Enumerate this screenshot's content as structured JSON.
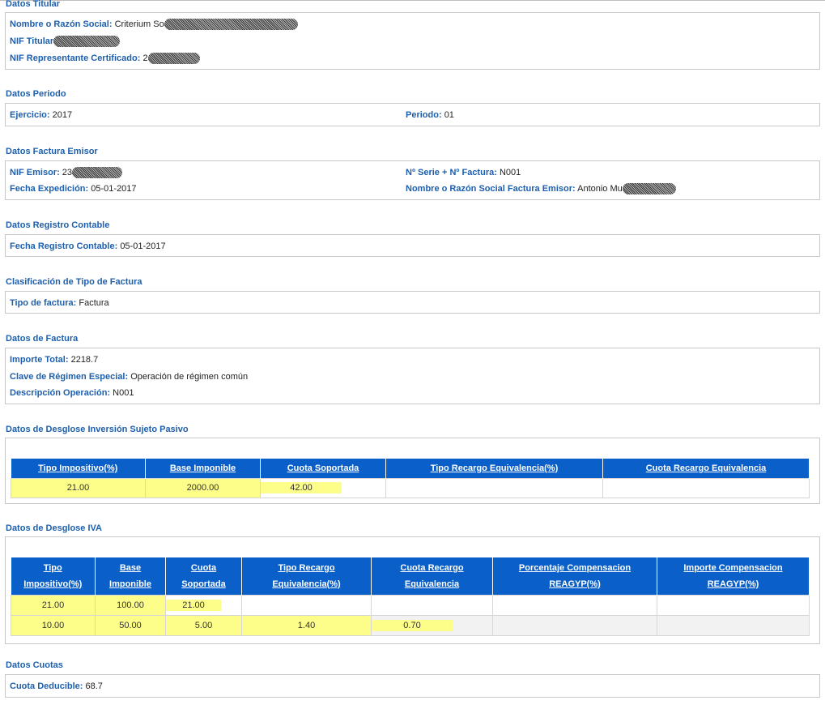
{
  "titular": {
    "title": "Datos Titular",
    "nombre_label": "Nombre o Razón Social:",
    "nombre_value": "Criterium So",
    "nif_label": "NIF Titular",
    "nif_value": "",
    "nif_rep_label": "NIF Representante Certificado:",
    "nif_rep_value": "2"
  },
  "periodo": {
    "title": "Datos Periodo",
    "ejercicio_label": "Ejercicio:",
    "ejercicio_value": "2017",
    "periodo_label": "Periodo:",
    "periodo_value": "01"
  },
  "factura_emisor": {
    "title": "Datos Factura Emisor",
    "nif_label": "NIF Emisor:",
    "nif_value": "23",
    "serie_label": "Nº Serie + Nº Factura:",
    "serie_value": "N001",
    "fecha_label": "Fecha Expedición:",
    "fecha_value": "05-01-2017",
    "nombre_label": "Nombre o Razón Social Factura Emisor:",
    "nombre_value": "Antonio Mu"
  },
  "registro": {
    "title": "Datos Registro Contable",
    "fecha_label": "Fecha Registro Contable:",
    "fecha_value": "05-01-2017"
  },
  "clasificacion": {
    "title": "Clasificación de Tipo de Factura",
    "tipo_label": "Tipo de factura:",
    "tipo_value": "Factura"
  },
  "factura": {
    "title": "Datos de Factura",
    "importe_label": "Importe Total:",
    "importe_value": "2218.7",
    "clave_label": "Clave de Régimen Especial:",
    "clave_value": "Operación de régimen común",
    "desc_label": "Descripción Operación:",
    "desc_value": "N001"
  },
  "isp": {
    "title": "Datos de Desglose Inversión Sujeto Pasivo",
    "headers": [
      "Tipo Impositivo(%)",
      "Base Imponible",
      "Cuota Soportada",
      "Tipo Recargo Equivalencia(%)",
      "Cuota Recargo Equivalencia"
    ],
    "rows": [
      [
        "21.00",
        "2000.00",
        "42.00",
        "",
        ""
      ]
    ]
  },
  "iva": {
    "title": "Datos de Desglose IVA",
    "headers": [
      [
        "Tipo",
        "Impositivo(%)"
      ],
      [
        "Base",
        "Imponible"
      ],
      [
        "Cuota",
        "Soportada"
      ],
      [
        "Tipo Recargo",
        "Equivalencia(%)"
      ],
      [
        "Cuota Recargo",
        "Equivalencia"
      ],
      [
        "Porcentaje Compensacion",
        "REAGYP(%)"
      ],
      [
        "Importe Compensacion",
        "REAGYP(%)"
      ]
    ],
    "rows": [
      [
        "21.00",
        "100.00",
        "21.00",
        "",
        "",
        "",
        ""
      ],
      [
        "10.00",
        "50.00",
        "5.00",
        "1.40",
        "0.70",
        "",
        ""
      ]
    ]
  },
  "cuotas": {
    "title": "Datos Cuotas",
    "deducible_label": "Cuota Deducible:",
    "deducible_value": "68.7"
  }
}
